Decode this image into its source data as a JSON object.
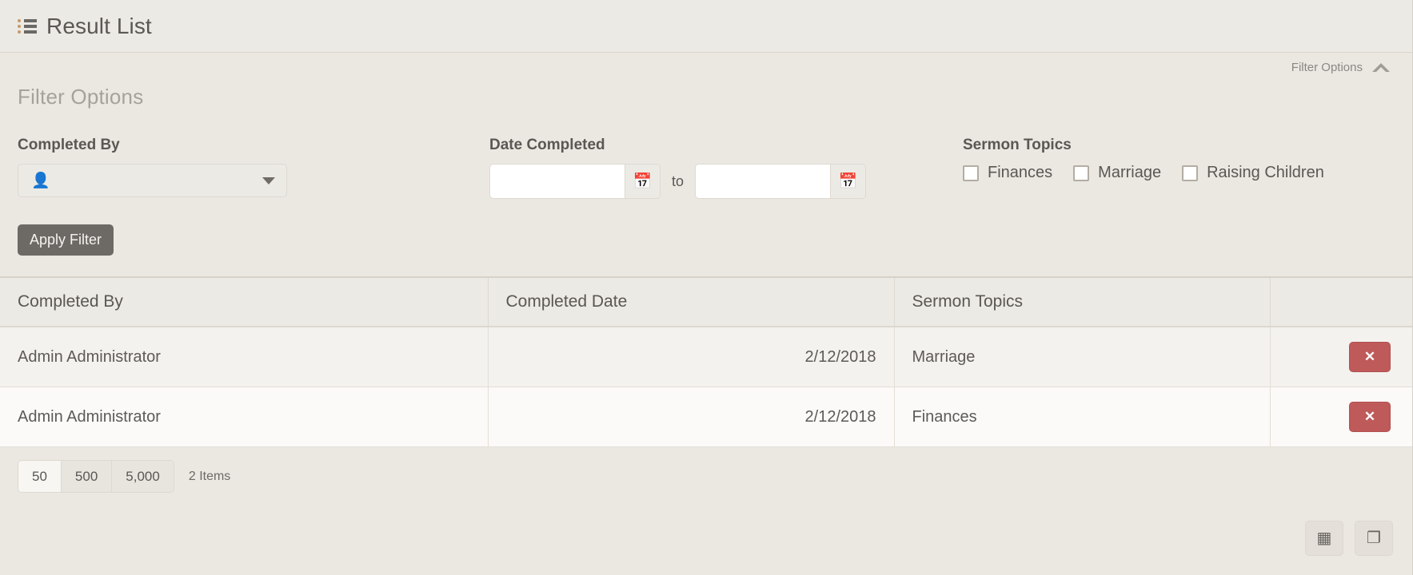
{
  "header": {
    "title": "Result List",
    "icon": "list-icon"
  },
  "filter_toggle": {
    "label": "Filter Options",
    "icon": "chevron-up-icon"
  },
  "filter": {
    "legend": "Filter Options",
    "completed_by": {
      "label": "Completed By",
      "value": "",
      "person_icon": "person-icon",
      "caret_icon": "caret-down-icon"
    },
    "date_completed": {
      "label": "Date Completed",
      "from_value": "",
      "from_placeholder": "",
      "to_value": "",
      "to_placeholder": "",
      "separator": "to",
      "calendar_icon": "calendar-icon"
    },
    "sermon_topics": {
      "label": "Sermon Topics",
      "options": [
        {
          "label": "Finances",
          "checked": false
        },
        {
          "label": "Marriage",
          "checked": false
        },
        {
          "label": "Raising Children",
          "checked": false
        }
      ]
    },
    "apply_button": "Apply Filter"
  },
  "grid": {
    "columns": [
      "Completed By",
      "Completed Date",
      "Sermon Topics",
      ""
    ],
    "rows": [
      {
        "completed_by": "Admin Administrator",
        "completed_date": "2/12/2018",
        "sermon_topics": "Marriage",
        "delete_label": "✕"
      },
      {
        "completed_by": "Admin Administrator",
        "completed_date": "2/12/2018",
        "sermon_topics": "Finances",
        "delete_label": "✕"
      }
    ],
    "page_sizes": [
      "50",
      "500",
      "5,000"
    ],
    "active_page_size": "50",
    "item_count": "2 Items",
    "actions": [
      {
        "name": "excel-export-icon",
        "glyph": "▦"
      },
      {
        "name": "copy-icon",
        "glyph": "❐"
      }
    ]
  },
  "colors": {
    "page_bg": "#ebe8e2",
    "header_bg": "#eceae4",
    "delete_red": "#bf5a5a",
    "apply_gray": "#6d6a66",
    "accent_tan": "#c79a6b"
  }
}
